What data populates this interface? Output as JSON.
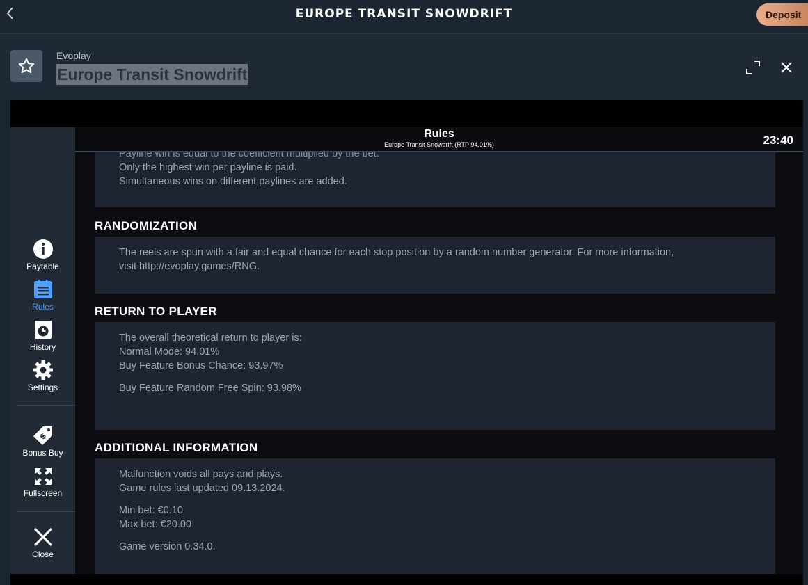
{
  "topbar": {
    "title": "EUROPE TRANSIT SNOWDRIFT",
    "deposit_label": "Deposit"
  },
  "game": {
    "provider": "Evoplay",
    "name": "Europe Transit Snowdrift"
  },
  "sidebar": {
    "items": [
      {
        "label": "Paytable"
      },
      {
        "label": "Rules"
      },
      {
        "label": "History"
      },
      {
        "label": "Settings"
      },
      {
        "label": "Bonus Buy"
      },
      {
        "label": "Fullscreen"
      },
      {
        "label": "Close"
      }
    ],
    "active_color": "#4da0ff"
  },
  "rules": {
    "title": "Rules",
    "subtitle": "Europe Transit Snowdrift (RTP 94.01%)",
    "clock": "23:40",
    "paylines": {
      "lines": [
        "Payline win is equal to the coefficient multiplied by the bet.",
        "Only the highest win per payline is paid.",
        "Simultaneous wins on different paylines are added."
      ]
    },
    "randomization": {
      "heading": "RANDOMIZATION",
      "lines": [
        "The reels are spun with a fair and equal chance for each stop position by a random number generator. For more information,",
        "visit http://evoplay.games/RNG."
      ]
    },
    "rtp": {
      "heading": "RETURN TO PLAYER",
      "lines": [
        "The overall theoretical return to player is:",
        "Normal Mode: 94.01%",
        "Buy Feature Bonus Chance: 93.97%",
        "Buy Feature Random Free Spin: 93.98%"
      ]
    },
    "additional": {
      "heading": "ADDITIONAL INFORMATION",
      "lines": [
        "Malfunction voids all pays and plays.",
        "Game rules last updated 09.13.2024.",
        "Min bet: €0.10",
        "Max bet: €20.00",
        "Game version 0.34.0."
      ]
    }
  }
}
